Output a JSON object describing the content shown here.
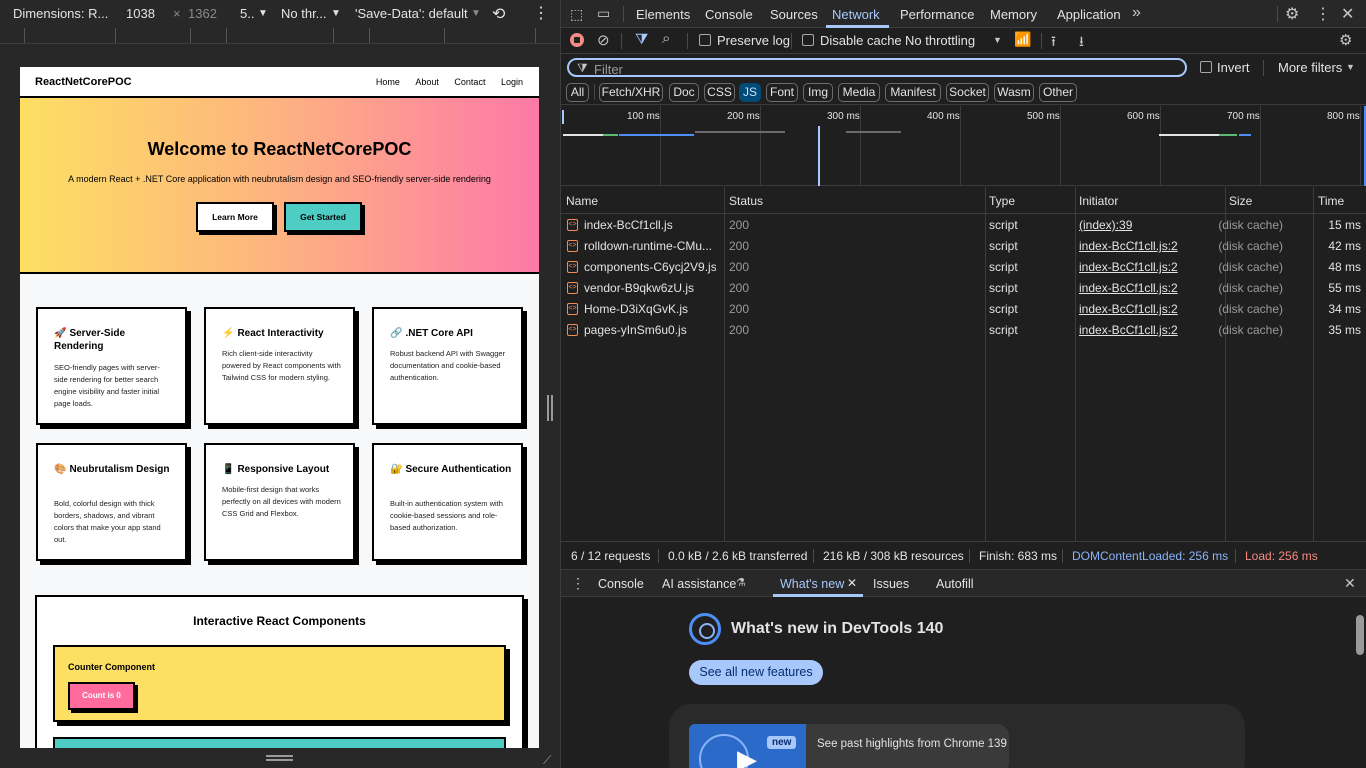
{
  "device_toolbar": {
    "dimensions_label": "Dimensions: R...",
    "width": "1038",
    "times": "×",
    "height": "1362",
    "zoom": "5..",
    "throttle": "No thr...",
    "save_data": "'Save-Data': default"
  },
  "site": {
    "brand": "ReactNetCorePOC",
    "nav": [
      "Home",
      "About",
      "Contact",
      "Login"
    ],
    "hero_title": "Welcome to ReactNetCorePOC",
    "hero_subtitle": "A modern React + .NET Core application with neubrutalism design and SEO-friendly server-side rendering",
    "btn_learn": "Learn More",
    "btn_start": "Get Started",
    "cards": [
      {
        "icon": "🚀",
        "title": "Server-Side Rendering",
        "desc": "SEO-friendly pages with server-side rendering for better search engine visibility and faster initial page loads."
      },
      {
        "icon": "⚡",
        "title": "React Interactivity",
        "desc": "Rich client-side interactivity powered by React components with Tailwind CSS for modern styling."
      },
      {
        "icon": "🔗",
        "title": ".NET Core API",
        "desc": "Robust backend API with Swagger documentation and cookie-based authentication."
      },
      {
        "icon": "🎨",
        "title": "Neubrutalism Design",
        "desc": "Bold, colorful design with thick borders, shadows, and vibrant colors that make your app stand out."
      },
      {
        "icon": "📱",
        "title": "Responsive Layout",
        "desc": "Mobile-first design that works perfectly on all devices with modern CSS Grid and Flexbox."
      },
      {
        "icon": "🔐",
        "title": "Secure Authentication",
        "desc": "Built-in authentication system with cookie-based sessions and role-based authorization."
      }
    ],
    "interactive_title": "Interactive React Components",
    "counter_title": "Counter Component",
    "counter_button": "Count is 0"
  },
  "devtools": {
    "tabs": [
      "Elements",
      "Console",
      "Sources",
      "Network",
      "Performance",
      "Memory",
      "Application"
    ],
    "active_tab": "Network",
    "toolbar": {
      "preserve_log": "Preserve log",
      "disable_cache": "Disable cache",
      "throttling": "No throttling"
    },
    "filter_placeholder": "Filter",
    "invert": "Invert",
    "more_filters": "More filters",
    "type_filters": [
      "All",
      "Fetch/XHR",
      "Doc",
      "CSS",
      "JS",
      "Font",
      "Img",
      "Media",
      "Manifest",
      "Socket",
      "Wasm",
      "Other"
    ],
    "active_type": "JS",
    "timeline_ticks": [
      "100 ms",
      "200 ms",
      "300 ms",
      "400 ms",
      "500 ms",
      "600 ms",
      "700 ms",
      "800 ms"
    ],
    "columns": [
      "Name",
      "Status",
      "Type",
      "Initiator",
      "Size",
      "Time"
    ],
    "rows": [
      {
        "name": "index-BcCf1cll.js",
        "status": "200",
        "type": "script",
        "initiator": "(index):39",
        "size": "(disk cache)",
        "time": "15 ms"
      },
      {
        "name": "rolldown-runtime-CMu...",
        "status": "200",
        "type": "script",
        "initiator": "index-BcCf1cll.js:2",
        "size": "(disk cache)",
        "time": "42 ms"
      },
      {
        "name": "components-C6ycj2V9.js",
        "status": "200",
        "type": "script",
        "initiator": "index-BcCf1cll.js:2",
        "size": "(disk cache)",
        "time": "48 ms"
      },
      {
        "name": "vendor-B9qkw6zU.js",
        "status": "200",
        "type": "script",
        "initiator": "index-BcCf1cll.js:2",
        "size": "(disk cache)",
        "time": "55 ms"
      },
      {
        "name": "Home-D3iXqGvK.js",
        "status": "200",
        "type": "script",
        "initiator": "index-BcCf1cll.js:2",
        "size": "(disk cache)",
        "time": "34 ms"
      },
      {
        "name": "pages-yInSm6u0.js",
        "status": "200",
        "type": "script",
        "initiator": "index-BcCf1cll.js:2",
        "size": "(disk cache)",
        "time": "35 ms"
      }
    ],
    "summary": {
      "requests": "6 / 12 requests",
      "transferred": "0.0 kB / 2.6 kB transferred",
      "resources": "216 kB / 308 kB resources",
      "finish": "Finish: 683 ms",
      "domcontentloaded": "DOMContentLoaded: 256 ms",
      "load": "Load: 256 ms"
    },
    "drawer_tabs": [
      "Console",
      "AI assistance",
      "What's new",
      "Issues",
      "Autofill"
    ],
    "whats_new_title": "What's new in DevTools 140",
    "see_all": "See all new features",
    "new_badge": "new",
    "highlight_text": "See past highlights from Chrome 139"
  },
  "colors": {
    "accent": "#a8c7fa",
    "load": "#f28b82",
    "dcl": "#8ab4f8",
    "yellow": "#fddf63",
    "pink": "#fd79a8",
    "teal": "#4ecdc4"
  }
}
